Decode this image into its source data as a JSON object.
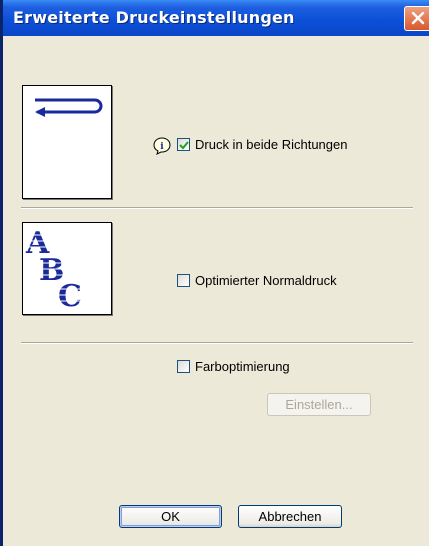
{
  "window": {
    "title": "Erweiterte Druckeinstellungen"
  },
  "options": {
    "duplex": {
      "label": "Druck in beide Richtungen",
      "checked": true
    },
    "normal_print": {
      "label": "Optimierter Normaldruck",
      "checked": false
    },
    "color_opt": {
      "label": "Farboptimierung",
      "checked": false
    }
  },
  "buttons": {
    "settings": "Einstellen...",
    "ok": "OK",
    "cancel": "Abbrechen"
  },
  "icons": {
    "info": "info-icon",
    "close": "close-icon",
    "duplex_preview": "duplex-preview-icon",
    "text_preview": "abc-preview-icon"
  },
  "preview_text": "ABC",
  "colors": {
    "titlebar": "#0B4FD8",
    "close": "#D8582C",
    "face": "#ECE9D8",
    "text_preview": "#1A2A9A"
  }
}
